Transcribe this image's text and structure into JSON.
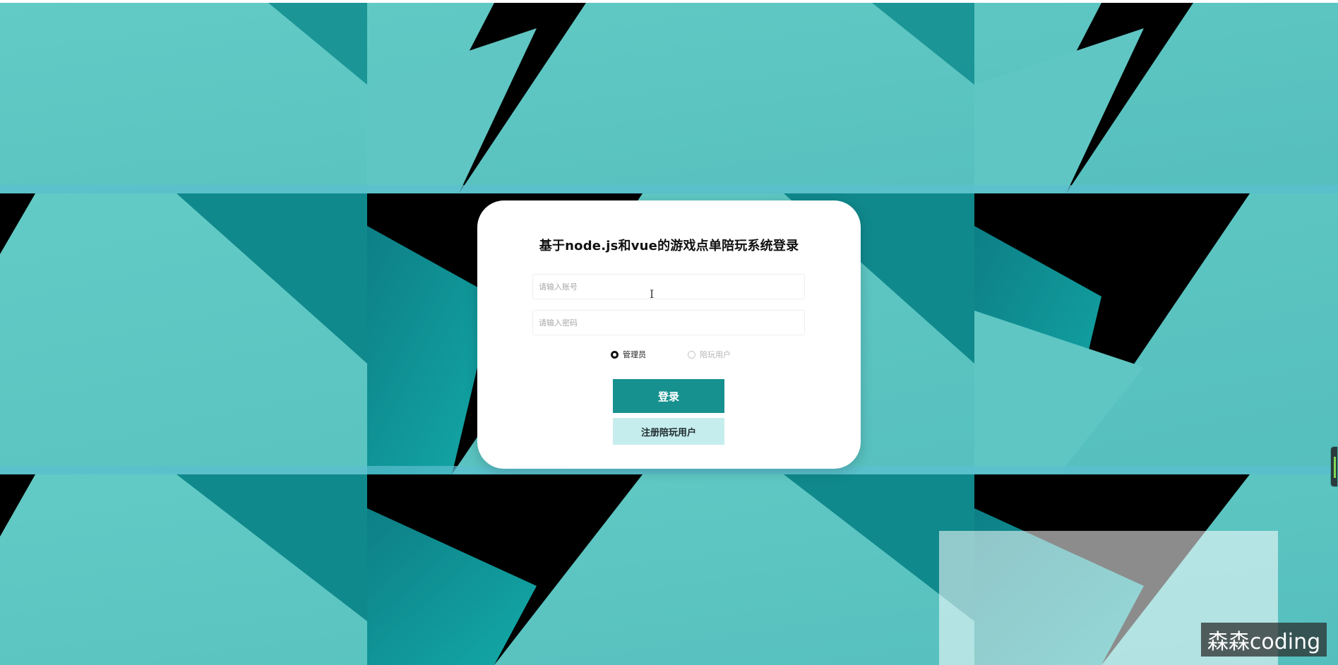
{
  "page": {
    "title": "基于node.js和vue的游戏点单陪玩系统登录"
  },
  "form": {
    "account_placeholder": "请输入账号",
    "account_value": "",
    "password_placeholder": "请输入密码",
    "password_value": ""
  },
  "roles": {
    "options": [
      {
        "label": "管理员",
        "selected": true
      },
      {
        "label": "陪玩用户",
        "selected": false
      }
    ]
  },
  "buttons": {
    "login_label": "登录",
    "register_label": "注册陪玩用户"
  },
  "watermark": {
    "text": "森森coding"
  },
  "colors": {
    "background_teal": "#5ec5c0",
    "dark_teal": "#0e8a8c",
    "login_button": "#16918f",
    "register_button": "#c6edee"
  }
}
